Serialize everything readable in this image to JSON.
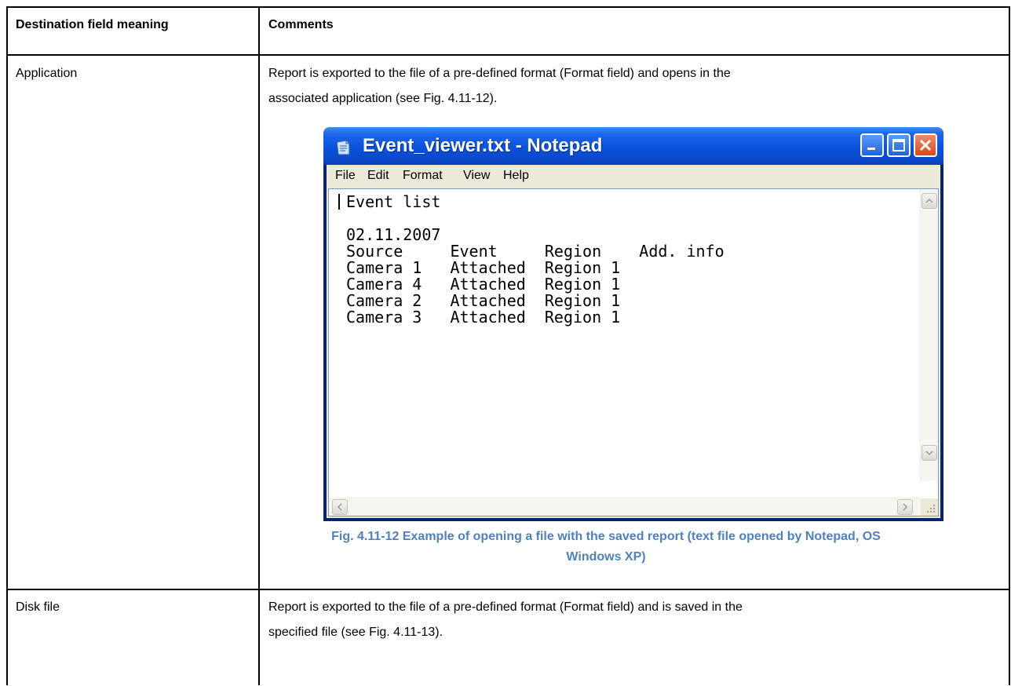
{
  "table": {
    "headers": [
      "Destination field meaning",
      "Comments"
    ],
    "rows": [
      {
        "destination": "Application",
        "comment_line1": "Report is exported to the file of a pre-defined format (Format field) and opens in the",
        "comment_line2": "associated application (see Fig. 4.11-12)."
      },
      {
        "destination": "Disk file",
        "comment_line1": "Report is exported to the file of a pre-defined format (Format field) and is saved in the",
        "comment_line2": "specified file (see Fig. 4.11-13)."
      }
    ]
  },
  "notepad": {
    "title": "Event_viewer.txt - Notepad",
    "menu": [
      "File",
      "Edit",
      "Format",
      "View",
      "Help"
    ],
    "content": "Event list\n\n02.11.2007\nSource     Event     Region    Add. info\nCamera 1   Attached  Region 1\nCamera 4   Attached  Region 1\nCamera 2   Attached  Region 1\nCamera 3   Attached  Region 1",
    "icons": [
      "notepad-icon",
      "minimize-icon",
      "maximize-icon",
      "close-icon"
    ]
  },
  "figure": {
    "caption_line1": "Fig. 4.11-12 Example of opening a file with the saved report (text file opened by Notepad, OS",
    "caption_line2": "Windows XP)"
  },
  "colors": {
    "caption": "#4f81bd",
    "titlebar": "#0a52dd",
    "close_button": "#d94a1b"
  }
}
